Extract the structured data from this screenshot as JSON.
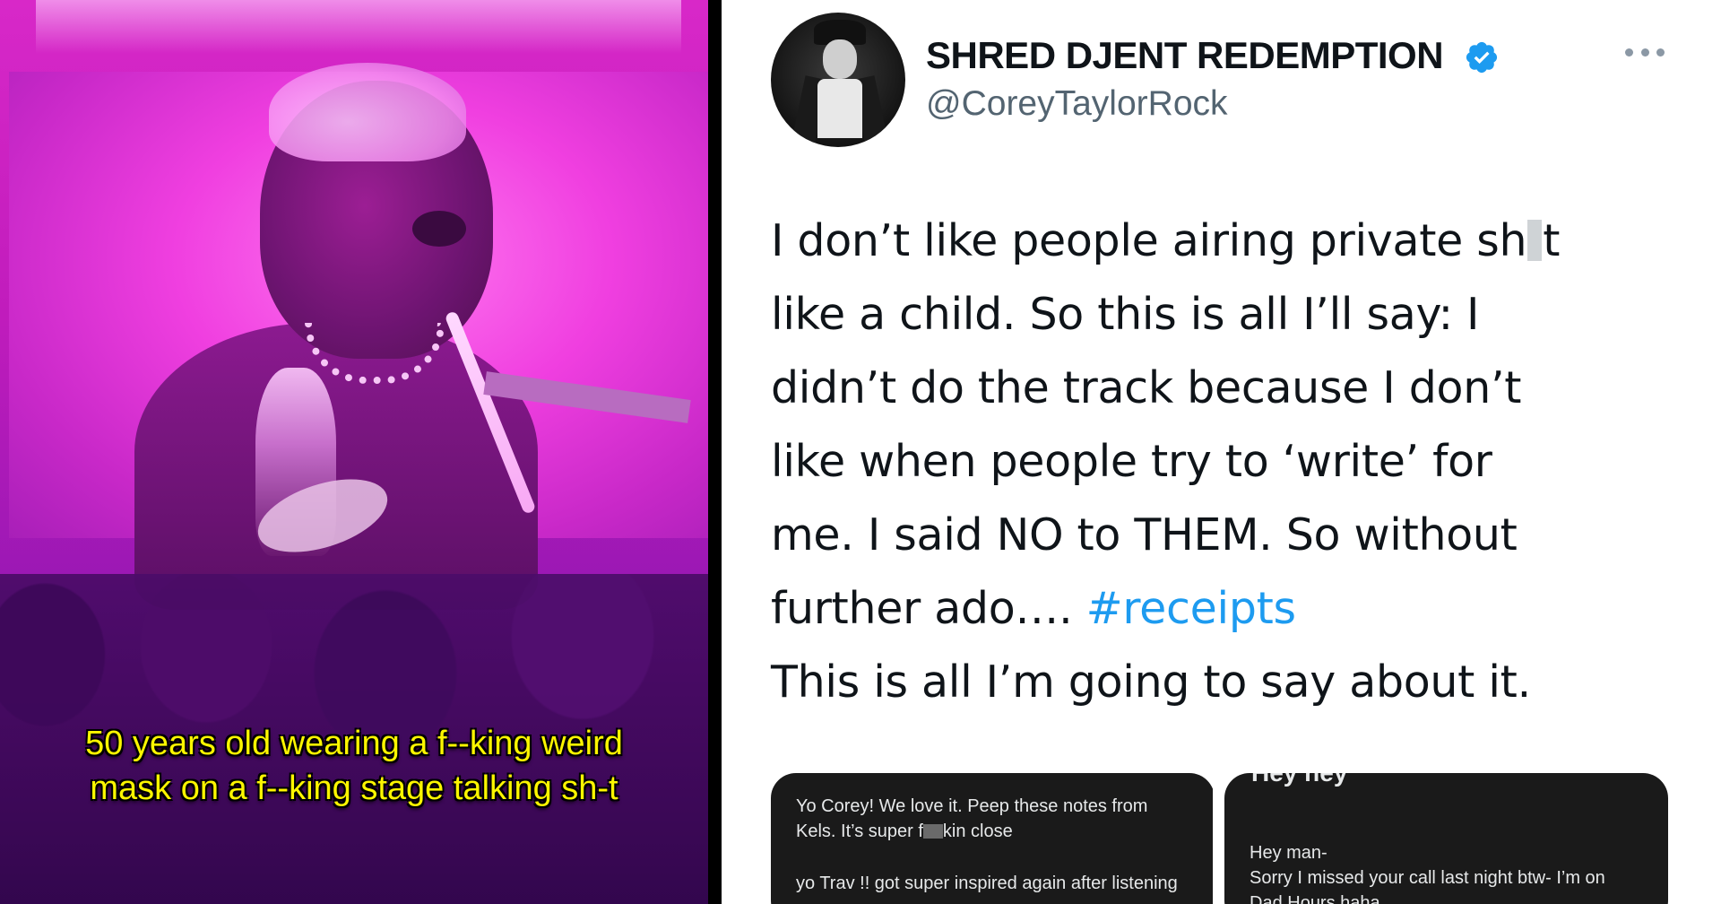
{
  "left_panel": {
    "caption_line1": "50 years old wearing a f--king weird",
    "caption_line2": "mask on a f--king stage talking sh-t"
  },
  "tweet": {
    "display_name": "SHRED DJENT REDEMPTION",
    "handle": "@CoreyTaylorRock",
    "verified": true,
    "body_lines": [
      "I don’t like people airing private sh",
      "t",
      "like a child. So this is all I’ll say: I",
      "didn’t do the track because I don’t",
      "like when people try to ‘write’ for",
      "me. I said NO to THEM. So without",
      "further ado….",
      "#receipts",
      "This is all I’m going to say about it."
    ],
    "hashtag_color": "#1d9bf0"
  },
  "attachments": {
    "left_card": {
      "line1": "Yo Corey! We love it. Peep these notes from",
      "line2a": "Kels. It’s super f",
      "line2b": "kin close",
      "line3": "yo Trav !! got super inspired again after listening"
    },
    "right_card": {
      "top_cut": "Hey hey",
      "line1": "Hey man-",
      "line2": "Sorry I missed your call last night btw- I’m on",
      "line3": "Dad Hours haha"
    }
  }
}
